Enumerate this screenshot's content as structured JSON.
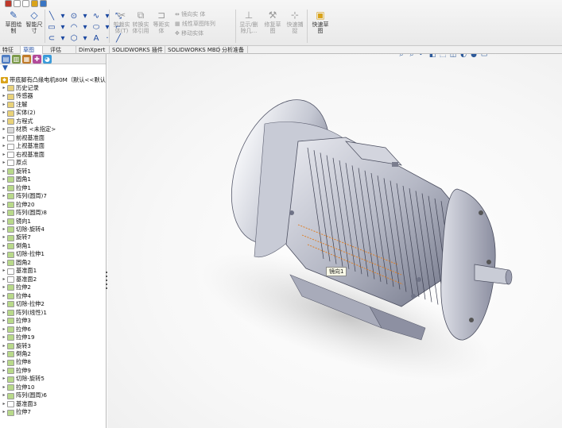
{
  "ribbon": {
    "quick_icons": [
      {
        "name": "app-logo-icon",
        "color": "#c0392b"
      },
      {
        "name": "new-icon",
        "color": "#ffffff"
      },
      {
        "name": "cursor-icon",
        "color": "#ffffff"
      },
      {
        "name": "rebuild-icon",
        "color": "#d9a31a"
      },
      {
        "name": "undo-icon",
        "color": "#3a76c4"
      }
    ],
    "sketch_btn": "草图绘\n制",
    "smart_dim_btn": "智能尺\n寸",
    "mirror_btn": "镜向实\n体",
    "trim_btn": "剪裁实\n体(T)",
    "convert_btn": "转换实\n体引用",
    "offset_btn": "等距实\n体",
    "linear_pattern_label": "线性草图阵列",
    "move_label": "移动实体",
    "show_relations_btn": "显示/删\n除几...",
    "repair_btn": "修复草\n图",
    "quick_snap_btn": "快速捕\n捉",
    "instant2d_btn": "快速草\n图"
  },
  "command_tabs": [
    {
      "label": "特征"
    },
    {
      "label": "草图"
    },
    {
      "label": "评估"
    },
    {
      "label": "DimXpert"
    },
    {
      "label": "SOLIDWORKS 插件"
    },
    {
      "label": "SOLIDWORKS MBD"
    },
    {
      "label": "分析准备"
    }
  ],
  "tree": {
    "root": "带底脚有凸缘电机80M（默认<<默认",
    "items": [
      {
        "label": "历史记录",
        "icon": "history-icon",
        "color": "#e9d27a"
      },
      {
        "label": "传感器",
        "icon": "sensor-icon",
        "color": "#e9d27a"
      },
      {
        "label": "注解",
        "icon": "annotation-icon",
        "color": "#e9d27a"
      },
      {
        "label": "实体(2)",
        "icon": "solid-bodies-icon",
        "color": "#e9d27a"
      },
      {
        "label": "方程式",
        "icon": "equation-icon",
        "color": "#e9d27a"
      },
      {
        "label": "材质 <未指定>",
        "icon": "material-icon",
        "color": "#d8d8d8"
      },
      {
        "label": "前视基准面",
        "icon": "plane-icon",
        "color": "#ffffff"
      },
      {
        "label": "上视基准面",
        "icon": "plane-icon",
        "color": "#ffffff"
      },
      {
        "label": "右视基准面",
        "icon": "plane-icon",
        "color": "#ffffff"
      },
      {
        "label": "原点",
        "icon": "origin-icon",
        "color": "#ffffff"
      },
      {
        "label": "旋转1",
        "icon": "revolve-icon",
        "color": "#b8d98a"
      },
      {
        "label": "圆角1",
        "icon": "fillet-icon",
        "color": "#b8d98a"
      },
      {
        "label": "拉伸1",
        "icon": "extrude-icon",
        "color": "#b8d98a"
      },
      {
        "label": "阵列(圆周)7",
        "icon": "pattern-icon",
        "color": "#b8d98a"
      },
      {
        "label": "拉伸20",
        "icon": "extrude-icon",
        "color": "#b8d98a"
      },
      {
        "label": "阵列(圆周)8",
        "icon": "pattern-icon",
        "color": "#b8d98a"
      },
      {
        "label": "镜向1",
        "icon": "mirror-icon",
        "color": "#b8d98a"
      },
      {
        "label": "切除-旋转4",
        "icon": "cut-revolve-icon",
        "color": "#b8d98a"
      },
      {
        "label": "旋转7",
        "icon": "revolve-icon",
        "color": "#b8d98a"
      },
      {
        "label": "倒角1",
        "icon": "chamfer-icon",
        "color": "#b8d98a"
      },
      {
        "label": "切除-拉伸1",
        "icon": "cut-extrude-icon",
        "color": "#b8d98a"
      },
      {
        "label": "圆角2",
        "icon": "fillet-icon",
        "color": "#b8d98a"
      },
      {
        "label": "基准面1",
        "icon": "plane-icon",
        "color": "#ffffff"
      },
      {
        "label": "基准面2",
        "icon": "plane-icon",
        "color": "#ffffff"
      },
      {
        "label": "拉伸2",
        "icon": "extrude-icon",
        "color": "#b8d98a"
      },
      {
        "label": "拉伸4",
        "icon": "extrude-icon",
        "color": "#b8d98a"
      },
      {
        "label": "切除-拉伸2",
        "icon": "cut-extrude-icon",
        "color": "#b8d98a"
      },
      {
        "label": "阵列(线性)1",
        "icon": "pattern-icon",
        "color": "#b8d98a"
      },
      {
        "label": "拉伸3",
        "icon": "extrude-icon",
        "color": "#b8d98a"
      },
      {
        "label": "拉伸6",
        "icon": "extrude-icon",
        "color": "#b8d98a"
      },
      {
        "label": "拉伸19",
        "icon": "extrude-icon",
        "color": "#b8d98a"
      },
      {
        "label": "旋转3",
        "icon": "revolve-icon",
        "color": "#b8d98a"
      },
      {
        "label": "倒角2",
        "icon": "chamfer-icon",
        "color": "#b8d98a"
      },
      {
        "label": "拉伸8",
        "icon": "extrude-icon",
        "color": "#b8d98a"
      },
      {
        "label": "拉伸9",
        "icon": "extrude-icon",
        "color": "#b8d98a"
      },
      {
        "label": "切除-旋转5",
        "icon": "cut-revolve-icon",
        "color": "#b8d98a"
      },
      {
        "label": "拉伸10",
        "icon": "extrude-icon",
        "color": "#b8d98a"
      },
      {
        "label": "阵列(圆周)6",
        "icon": "pattern-icon",
        "color": "#b8d98a"
      },
      {
        "label": "基准面3",
        "icon": "plane-icon",
        "color": "#ffffff"
      },
      {
        "label": "拉伸7",
        "icon": "extrude-icon",
        "color": "#b8d98a"
      }
    ]
  },
  "viewport": {
    "tooltip": "镜向1"
  },
  "colors": {
    "accent": "#1a47a0",
    "highlight": "#e07a1a",
    "motor_body": "#c9ccd6"
  }
}
